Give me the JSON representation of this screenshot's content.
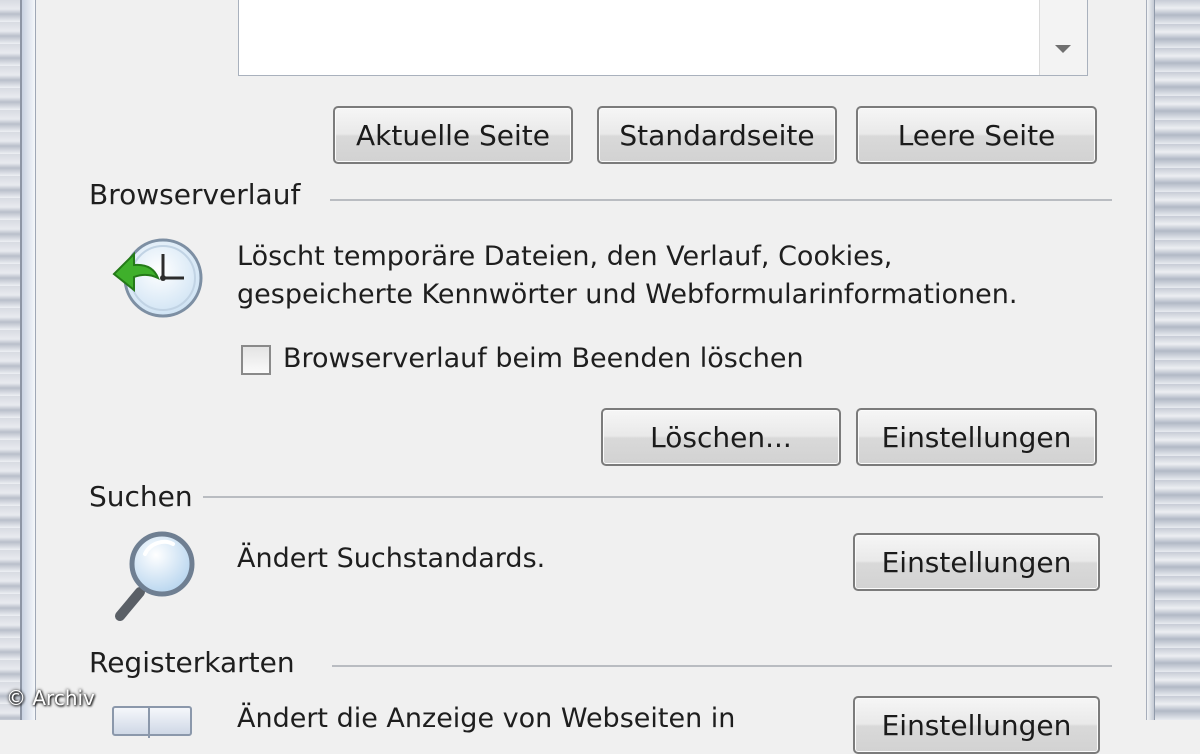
{
  "homepage": {
    "buttons": {
      "current": "Aktuelle Seite",
      "default": "Standardseite",
      "blank": "Leere Seite"
    }
  },
  "history": {
    "title": "Browserverlauf",
    "description_line1": "Löscht temporäre Dateien, den Verlauf, Cookies,",
    "description_line2": "gespeicherte Kennwörter und Webformularinformationen.",
    "checkbox_label": "Browserverlauf beim Beenden löschen",
    "checkbox_checked": false,
    "delete_button": "Löschen...",
    "settings_button": "Einstellungen",
    "icon": "history-clock-icon"
  },
  "search": {
    "title": "Suchen",
    "description": "Ändert Suchstandards.",
    "settings_button": "Einstellungen",
    "icon": "magnifier-icon"
  },
  "tabs": {
    "title": "Registerkarten",
    "description_partial": "Ändert die Anzeige von Webseiten in",
    "settings_button": "Einstellungen",
    "icon": "tabs-icon"
  },
  "watermark": "© Archiv",
  "colors": {
    "dialog_bg": "#f0f0f0",
    "clock_arrow_green": "#3fb02b",
    "clock_face": "#e7f2fb"
  }
}
